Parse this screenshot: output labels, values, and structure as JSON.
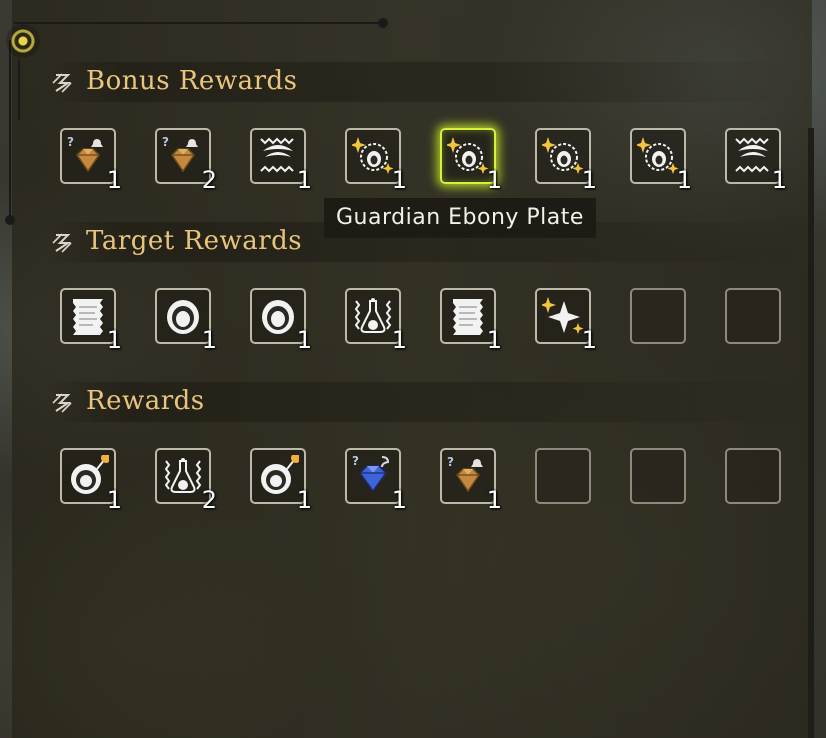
{
  "sections": [
    {
      "title": "Bonus Rewards",
      "slots": [
        {
          "icon": "gem-question-bell-icon",
          "qty": "1"
        },
        {
          "icon": "gem-question-bell-icon",
          "qty": "2"
        },
        {
          "icon": "hide-scale-icon",
          "qty": "1"
        },
        {
          "icon": "sparkle-shell-plate-icon",
          "qty": "1"
        },
        {
          "icon": "sparkle-shell-plate-icon",
          "qty": "1",
          "selected": true
        },
        {
          "icon": "sparkle-shell-plate-icon",
          "qty": "1"
        },
        {
          "icon": "sparkle-shell-plate-icon",
          "qty": "1"
        },
        {
          "icon": "hide-scale-icon",
          "qty": "1"
        }
      ]
    },
    {
      "title": "Target Rewards",
      "slots": [
        {
          "icon": "ticket-scroll-icon",
          "qty": "1"
        },
        {
          "icon": "shell-icon",
          "qty": "1"
        },
        {
          "icon": "shell-icon",
          "qty": "1"
        },
        {
          "icon": "flask-icon",
          "qty": "1"
        },
        {
          "icon": "ticket-scroll-icon",
          "qty": "1"
        },
        {
          "icon": "sparkle-star-icon",
          "qty": "1"
        },
        {
          "empty": true
        },
        {
          "empty": true
        }
      ]
    },
    {
      "title": "Rewards",
      "slots": [
        {
          "icon": "shell-pin-icon",
          "qty": "1"
        },
        {
          "icon": "flask-icon",
          "qty": "2"
        },
        {
          "icon": "shell-pin-icon",
          "qty": "1"
        },
        {
          "icon": "blue-gem-question-icon",
          "qty": "1"
        },
        {
          "icon": "gem-question-bell-icon",
          "qty": "1"
        },
        {
          "empty": true
        },
        {
          "empty": true
        },
        {
          "empty": true
        }
      ]
    }
  ],
  "tooltip": "Guardian Ebony Plate",
  "colors": {
    "header_text": "#e9c57c",
    "selection_glow": "#d8f23a",
    "slot_border": "#bdb9a8"
  }
}
